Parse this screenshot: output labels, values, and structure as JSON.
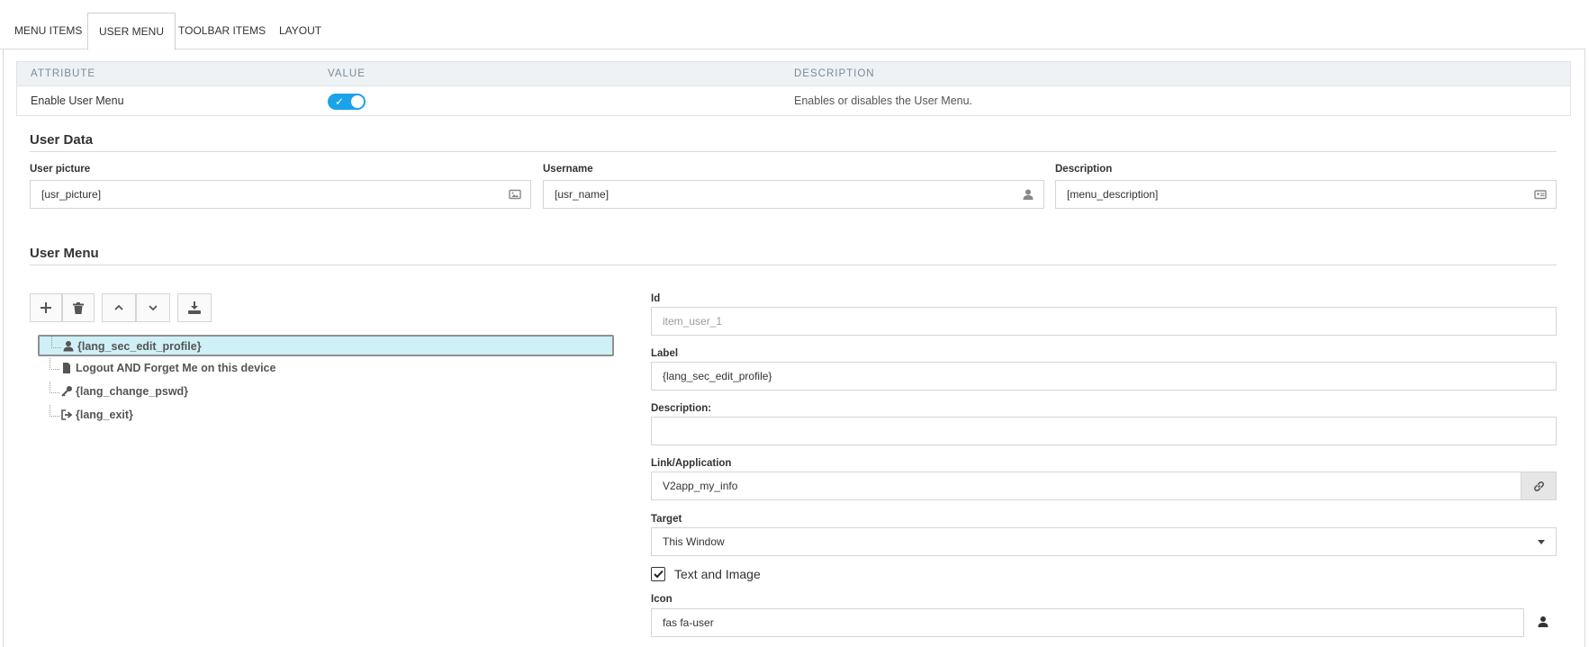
{
  "tabs": [
    {
      "label": "MENU ITEMS"
    },
    {
      "label": "USER MENU"
    },
    {
      "label": "TOOLBAR ITEMS"
    },
    {
      "label": "LAYOUT"
    }
  ],
  "attr_table": {
    "headers": {
      "attribute": "ATTRIBUTE",
      "value": "VALUE",
      "description": "DESCRIPTION"
    },
    "row": {
      "attribute": "Enable User Menu",
      "enabled": true,
      "description": "Enables or disables the User Menu."
    }
  },
  "user_data": {
    "title": "User Data",
    "picture": {
      "label": "User picture",
      "value": "[usr_picture]"
    },
    "username": {
      "label": "Username",
      "value": "[usr_name]"
    },
    "description": {
      "label": "Description",
      "value": "[menu_description]"
    }
  },
  "user_menu": {
    "title": "User Menu",
    "tree": [
      {
        "label": "{lang_sec_edit_profile}",
        "icon": "user-icon",
        "selected": true
      },
      {
        "label": "Logout AND Forget Me on this device",
        "icon": "file-icon",
        "selected": false
      },
      {
        "label": "{lang_change_pswd}",
        "icon": "key-icon",
        "selected": false
      },
      {
        "label": "{lang_exit}",
        "icon": "sign-out-icon",
        "selected": false
      }
    ]
  },
  "item_form": {
    "id": {
      "label": "Id",
      "value": "item_user_1"
    },
    "label": {
      "label": "Label",
      "value": "{lang_sec_edit_profile}"
    },
    "description": {
      "label": "Description:",
      "value": ""
    },
    "link": {
      "label": "Link/Application",
      "value": "V2app_my_info"
    },
    "target": {
      "label": "Target",
      "value": "This Window"
    },
    "text_and_image": {
      "label": "Text and Image",
      "checked": true
    },
    "icon": {
      "label": "Icon",
      "value": "fas fa-user"
    }
  },
  "colors": {
    "accent": "#1aa3ea",
    "selected_row": "#cff0f6",
    "header_bg": "#eef2f5"
  }
}
